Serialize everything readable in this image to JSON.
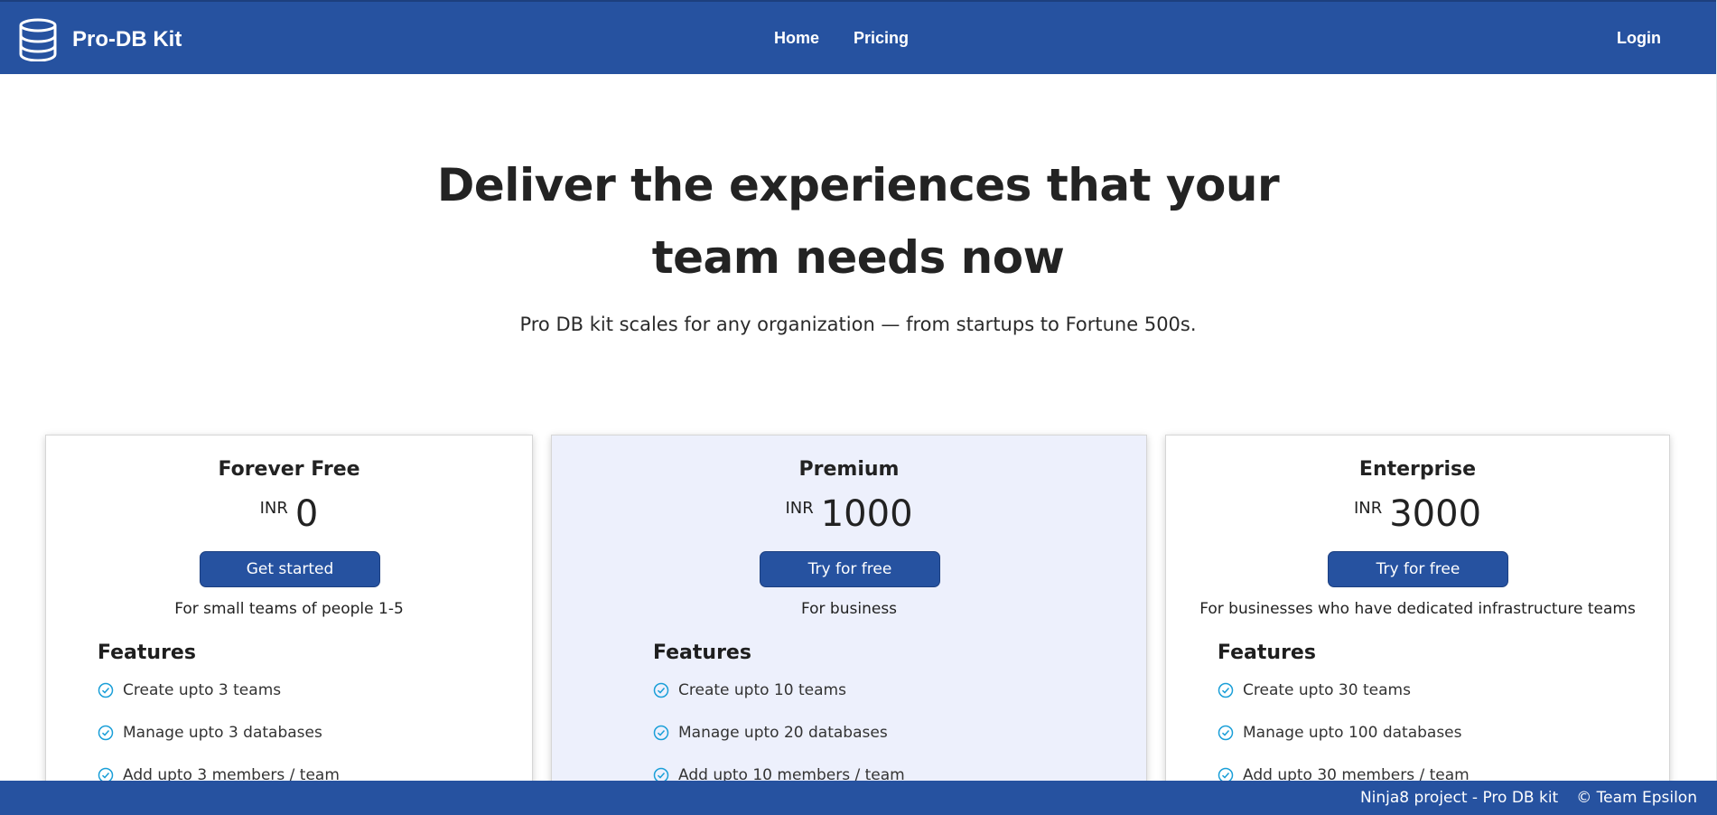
{
  "colors": {
    "primary": "#2652a0",
    "highlight_card": "#edf0fc",
    "check": "#1a9fd8"
  },
  "navbar": {
    "brand_icon": "database-icon",
    "brand_name": "Pro-DB Kit",
    "links": [
      "Home",
      "Pricing"
    ],
    "login": "Login"
  },
  "hero": {
    "title_line1": "Deliver the experiences that your",
    "title_line2": "team needs now",
    "subtitle": "Pro DB kit scales for any organization — from startups to Fortune 500s."
  },
  "plans": [
    {
      "name": "Forever Free",
      "currency": "INR",
      "price": "0",
      "cta": "Get started",
      "audience": "For small teams of people 1-5",
      "features_heading": "Features",
      "features": [
        "Create upto 3 teams",
        "Manage upto 3 databases",
        "Add upto 3 members / team"
      ]
    },
    {
      "name": "Premium",
      "currency": "INR",
      "price": "1000",
      "cta": "Try for free",
      "audience": "For business",
      "features_heading": "Features",
      "features": [
        "Create upto 10 teams",
        "Manage upto 20 databases",
        "Add upto 10 members / team"
      ]
    },
    {
      "name": "Enterprise",
      "currency": "INR",
      "price": "3000",
      "cta": "Try for free",
      "audience": "For businesses who have dedicated infrastructure teams",
      "features_heading": "Features",
      "features": [
        "Create upto 30 teams",
        "Manage upto 100 databases",
        "Add upto 30 members / team"
      ]
    }
  ],
  "footer": {
    "project": "Ninja8 project - Pro DB kit",
    "team": "© Team Epsilon"
  }
}
